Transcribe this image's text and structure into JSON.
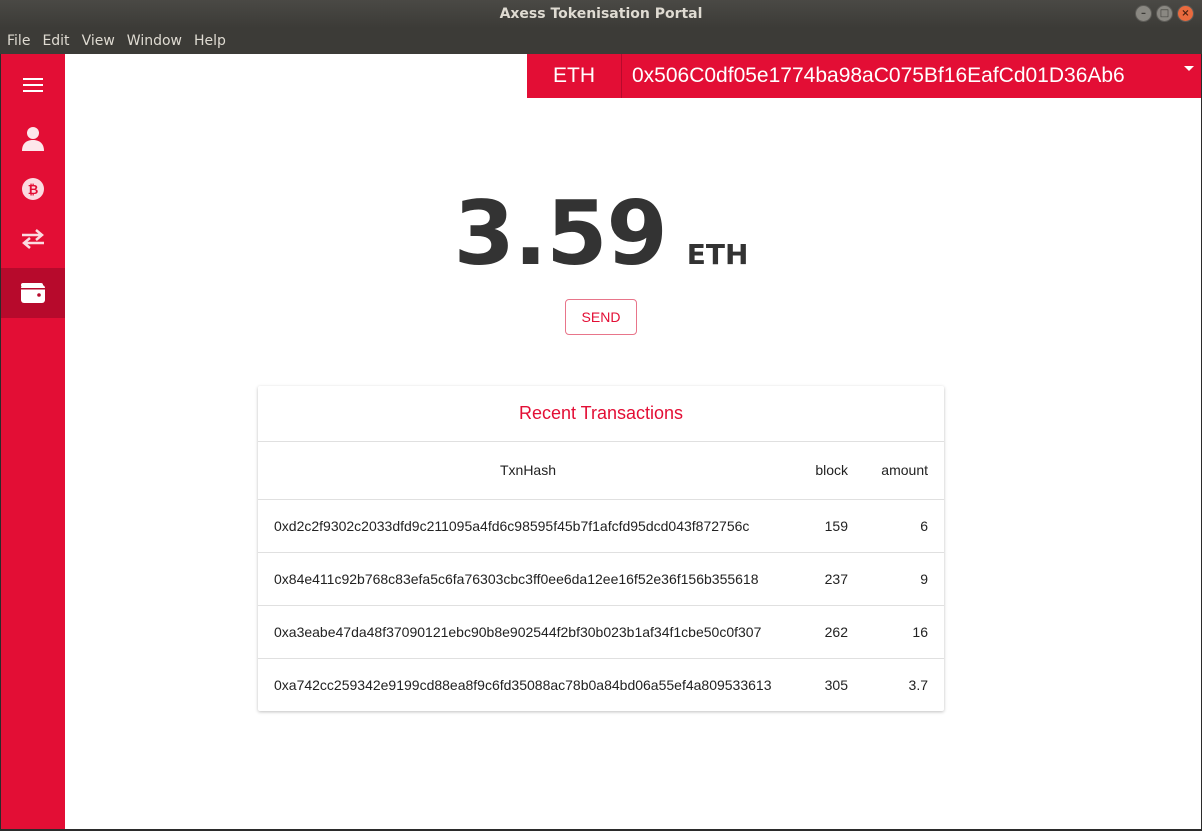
{
  "window": {
    "title": "Axess Tokenisation Portal"
  },
  "menubar": {
    "items": [
      "File",
      "Edit",
      "View",
      "Window",
      "Help"
    ]
  },
  "sidebar": {
    "items": [
      {
        "icon": "menu-icon"
      },
      {
        "icon": "user-icon"
      },
      {
        "icon": "bitcoin-icon"
      },
      {
        "icon": "transfer-icon"
      },
      {
        "icon": "wallet-icon",
        "active": true
      }
    ]
  },
  "header": {
    "currency": "ETH",
    "address": "0x506C0df05e1774ba98aC075Bf16EafCd01D36Ab6"
  },
  "balance": {
    "amount": "3.59",
    "unit": "ETH"
  },
  "send_label": "SEND",
  "transactions": {
    "title": "Recent Transactions",
    "columns": [
      "TxnHash",
      "block",
      "amount"
    ],
    "rows": [
      {
        "hash": "0xd2c2f9302c2033dfd9c211095a4fd6c98595f45b7f1afcfd95dcd043f872756c",
        "block": "159",
        "amount": "6"
      },
      {
        "hash": "0x84e411c92b768c83efa5c6fa76303cbc3ff0ee6da12ee16f52e36f156b355618",
        "block": "237",
        "amount": "9"
      },
      {
        "hash": "0xa3eabe47da48f37090121ebc90b8e902544f2bf30b023b1af34f1cbe50c0f307",
        "block": "262",
        "amount": "16"
      },
      {
        "hash": "0xa742cc259342e9199cd88ea8f9c6fd35088ac78b0a84bd06a55ef4a809533613",
        "block": "305",
        "amount": "3.7"
      }
    ]
  },
  "colors": {
    "accent": "#e30e35",
    "accent_dark": "#b70a2c"
  }
}
